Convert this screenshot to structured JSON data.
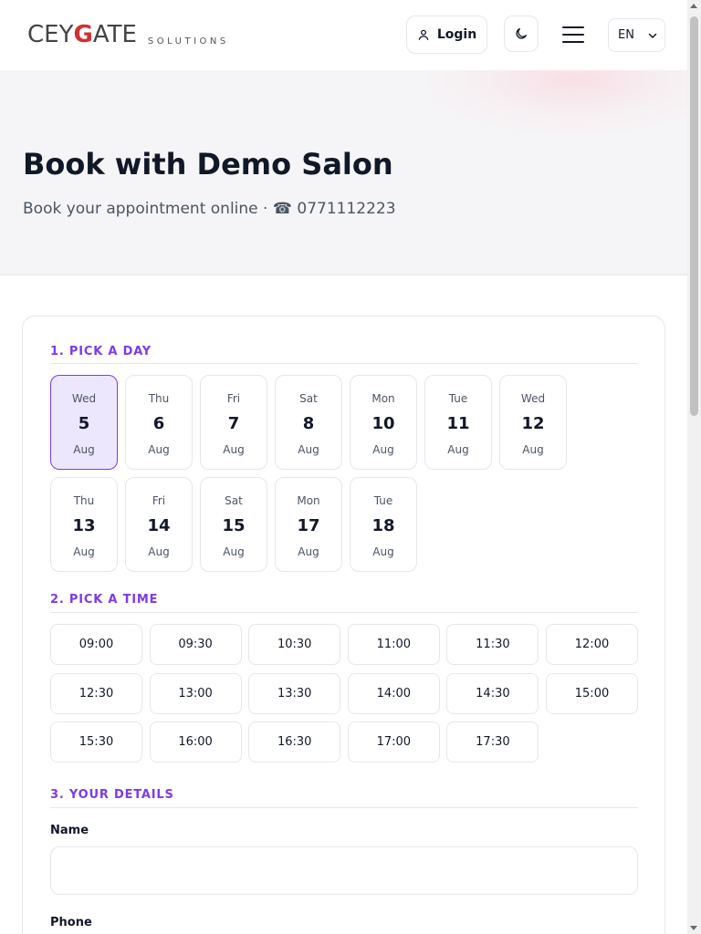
{
  "header": {
    "logo_text_left": "CEY",
    "logo_text_g": "G",
    "logo_text_right": "ATE",
    "logo_sub": "SOLUTIONS",
    "login_label": "Login",
    "language": "EN"
  },
  "hero": {
    "title": "Book with Demo Salon",
    "subtitle": "Book your appointment online · ☎ 0771112223"
  },
  "sections": {
    "pick_day": "1. PICK A DAY",
    "pick_time": "2. PICK A TIME",
    "details": "3. YOUR DETAILS"
  },
  "days": [
    {
      "dow": "Wed",
      "num": "5",
      "mon": "Aug",
      "selected": true
    },
    {
      "dow": "Thu",
      "num": "6",
      "mon": "Aug"
    },
    {
      "dow": "Fri",
      "num": "7",
      "mon": "Aug"
    },
    {
      "dow": "Sat",
      "num": "8",
      "mon": "Aug"
    },
    {
      "dow": "Mon",
      "num": "10",
      "mon": "Aug"
    },
    {
      "dow": "Tue",
      "num": "11",
      "mon": "Aug"
    },
    {
      "dow": "Wed",
      "num": "12",
      "mon": "Aug"
    },
    {
      "dow": "Thu",
      "num": "13",
      "mon": "Aug"
    },
    {
      "dow": "Fri",
      "num": "14",
      "mon": "Aug"
    },
    {
      "dow": "Sat",
      "num": "15",
      "mon": "Aug"
    },
    {
      "dow": "Mon",
      "num": "17",
      "mon": "Aug"
    },
    {
      "dow": "Tue",
      "num": "18",
      "mon": "Aug"
    }
  ],
  "times": [
    "09:00",
    "09:30",
    "10:30",
    "11:00",
    "11:30",
    "12:00",
    "12:30",
    "13:00",
    "13:30",
    "14:00",
    "14:30",
    "15:00",
    "15:30",
    "16:00",
    "16:30",
    "17:00",
    "17:30"
  ],
  "form": {
    "name_label": "Name",
    "name_value": "",
    "phone_label": "Phone"
  },
  "colors": {
    "accent": "#7c3aed",
    "selected_bg": "#ede7fd",
    "logo_red": "#d32f2f"
  },
  "icons": {
    "login": "user-icon",
    "theme": "moon-icon",
    "menu": "hamburger-icon",
    "lang": "chevron-down-icon"
  }
}
